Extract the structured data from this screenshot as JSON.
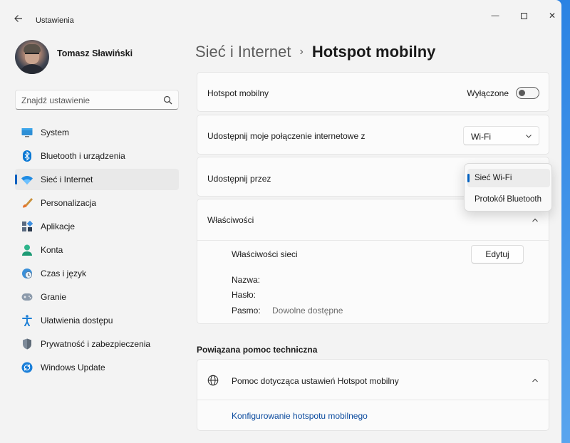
{
  "window": {
    "title": "Ustawienia",
    "controls": {
      "minimize": "—",
      "close": "✕"
    }
  },
  "user": {
    "name": "Tomasz Sławiński"
  },
  "search": {
    "placeholder": "Znajdź ustawienie"
  },
  "sidebar": {
    "items": [
      {
        "label": "System",
        "icon": "system-icon"
      },
      {
        "label": "Bluetooth i urządzenia",
        "icon": "bluetooth-icon"
      },
      {
        "label": "Sieć i Internet",
        "icon": "wifi-icon",
        "active": true
      },
      {
        "label": "Personalizacja",
        "icon": "brush-icon"
      },
      {
        "label": "Aplikacje",
        "icon": "apps-icon"
      },
      {
        "label": "Konta",
        "icon": "account-icon"
      },
      {
        "label": "Czas i język",
        "icon": "clock-globe-icon"
      },
      {
        "label": "Granie",
        "icon": "gamepad-icon"
      },
      {
        "label": "Ułatwienia dostępu",
        "icon": "accessibility-icon"
      },
      {
        "label": "Prywatność i zabezpieczenia",
        "icon": "shield-icon"
      },
      {
        "label": "Windows Update",
        "icon": "update-icon"
      }
    ]
  },
  "breadcrumb": {
    "parent": "Sieć i Internet",
    "separator": "›",
    "current": "Hotspot mobilny"
  },
  "hotspot": {
    "label": "Hotspot mobilny",
    "state_label": "Wyłączone",
    "enabled": false
  },
  "share_from": {
    "label": "Udostępnij moje połączenie internetowe z",
    "value": "Wi-Fi"
  },
  "share_over": {
    "label": "Udostępnij przez",
    "options": [
      "Sieć Wi-Fi",
      "Protokół Bluetooth"
    ],
    "selected": "Sieć Wi-Fi"
  },
  "properties": {
    "header": "Właściwości",
    "network_props_label": "Właściwości sieci",
    "edit_button": "Edytuj",
    "name_label": "Nazwa:",
    "name_value": "",
    "password_label": "Hasło:",
    "password_value": "",
    "band_label": "Pasmo:",
    "band_value": "Dowolne dostępne"
  },
  "related_help": {
    "section_title": "Powiązana pomoc techniczna",
    "header": "Pomoc dotycząca ustawień Hotspot mobilny",
    "link": "Konfigurowanie hotspotu mobilnego"
  },
  "colors": {
    "accent": "#0060c0",
    "link": "#0a4a9e",
    "desktop": "#1f7ae0"
  }
}
